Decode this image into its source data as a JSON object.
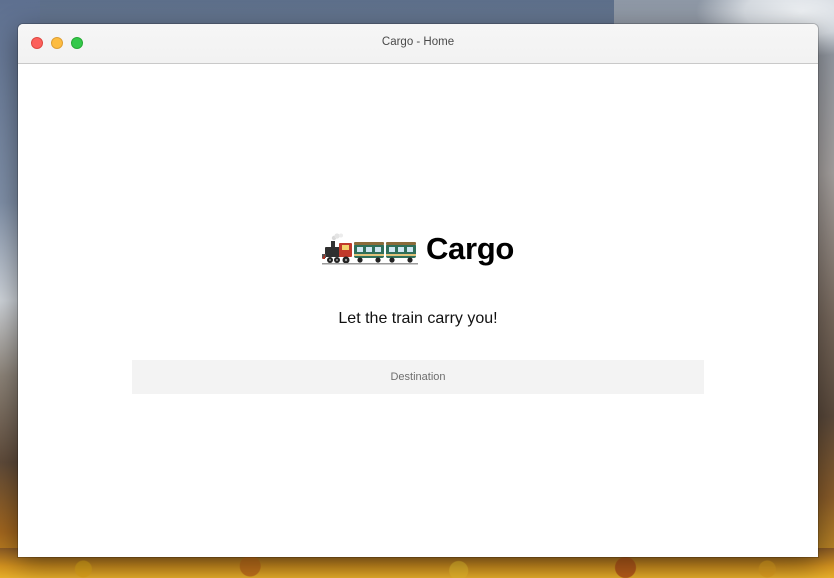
{
  "window": {
    "title": "Cargo - Home"
  },
  "brand": {
    "app_name": "Cargo",
    "icon": "train-icon"
  },
  "tagline": "Let the train carry you!",
  "destination": {
    "placeholder": "Destination",
    "value": ""
  },
  "colors": {
    "close": "#fc605c",
    "minimize": "#fdbc40",
    "zoom": "#34c84a",
    "input_background": "#f3f3f3"
  }
}
